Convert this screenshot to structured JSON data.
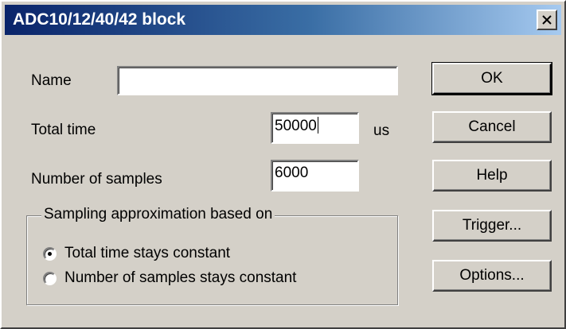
{
  "window": {
    "title": "ADC10/12/40/42 block"
  },
  "form": {
    "name_label": "Name",
    "name_value": "",
    "total_time_label": "Total time",
    "total_time_value": "50000",
    "total_time_unit": "us",
    "samples_label": "Number of samples",
    "samples_value": "6000"
  },
  "sampling_group": {
    "legend": "Sampling approximation based on",
    "options": [
      {
        "label": "Total time stays constant",
        "selected": true
      },
      {
        "label": "Number of samples stays constant",
        "selected": false
      }
    ]
  },
  "buttons": {
    "ok": "OK",
    "cancel": "Cancel",
    "help": "Help",
    "trigger": "Trigger...",
    "options": "Options..."
  }
}
